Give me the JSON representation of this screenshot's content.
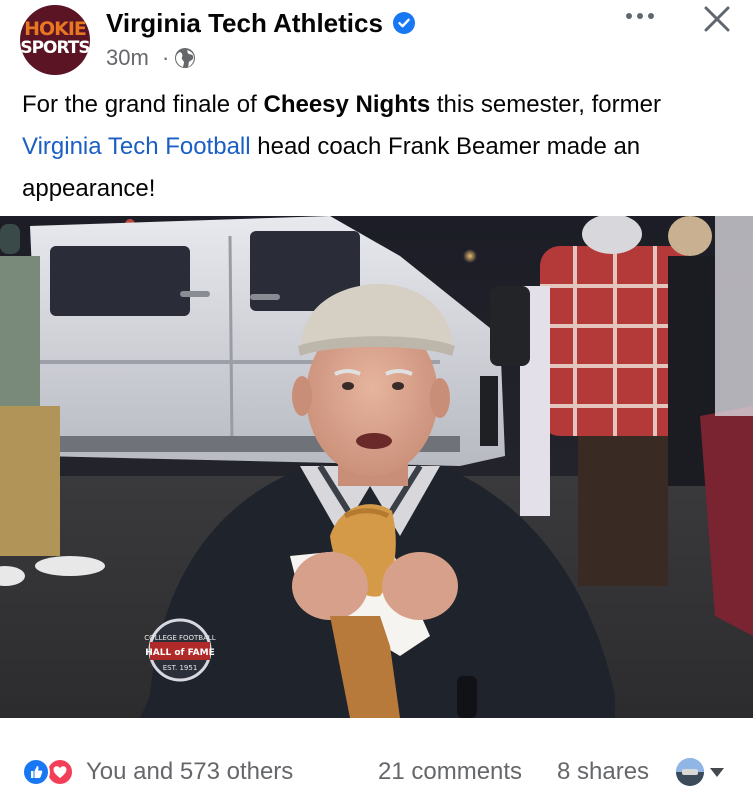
{
  "post": {
    "author": "Virginia Tech Athletics",
    "verified": true,
    "time": "30m",
    "separator": "·",
    "audience_icon": "globe-icon",
    "avatar": {
      "line1": "HOKIE",
      "line2": "SPORTS"
    },
    "caption": {
      "part1": "For the grand finale of ",
      "bold": "Cheesy Nights",
      "part2": " this semester, former ",
      "link": "Virginia Tech Football",
      "part3": " head coach Frank Beamer made an appearance!"
    },
    "photo_badge": {
      "line1": "COLLEGE FOOTBALL",
      "line2": "HALL of FAME",
      "line3": "EST. 1951"
    }
  },
  "footer": {
    "reactions": "You and 573 others",
    "comments": "21 comments",
    "shares": "8 shares"
  },
  "colors": {
    "link": "#1b5fc4",
    "like_blue": "#1877f2",
    "love_red": "#f33e58",
    "secondary_text": "#65676b",
    "brand_maroon": "#5a1424",
    "brand_orange": "#e87722"
  }
}
